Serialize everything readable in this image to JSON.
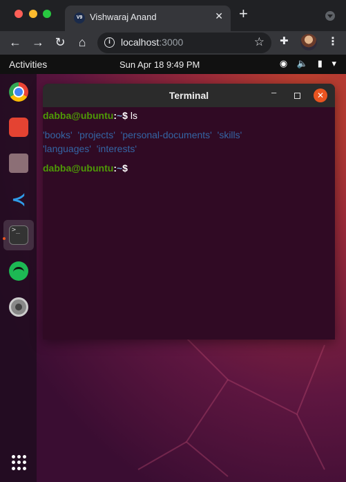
{
  "browser": {
    "tab_title": "Vishwaraj Anand",
    "tab_favicon_text": "V9",
    "url_host": "localhost",
    "url_port": ":3000",
    "icons": [
      "back-icon",
      "forward-icon",
      "reload-icon",
      "home-icon",
      "info-icon",
      "star-icon",
      "extensions-icon",
      "menu-icon"
    ]
  },
  "ubuntu": {
    "topbar": {
      "activities": "Activities",
      "clock": "Sun Apr 18  9:49 PM"
    },
    "dock": [
      "chrome",
      "todoist",
      "files",
      "vscode",
      "terminal",
      "spotify",
      "settings",
      "show-apps"
    ],
    "colors": {
      "accent": "#e95420",
      "prompt_user": "#4e9a06",
      "prompt_path": "#729fcf",
      "dir": "#3465a4",
      "terminal_bg": "#300a24"
    }
  },
  "terminal": {
    "title": "Terminal",
    "prompt_user": "dabba@ubuntu",
    "prompt_sep": ":",
    "prompt_path": "~",
    "prompt_symbol": "$",
    "command": "ls",
    "output_line1": [
      "'books'",
      "'projects'",
      "'personal-documents'",
      "'skills'"
    ],
    "output_line2": [
      "'languages'",
      "'interests'"
    ]
  }
}
